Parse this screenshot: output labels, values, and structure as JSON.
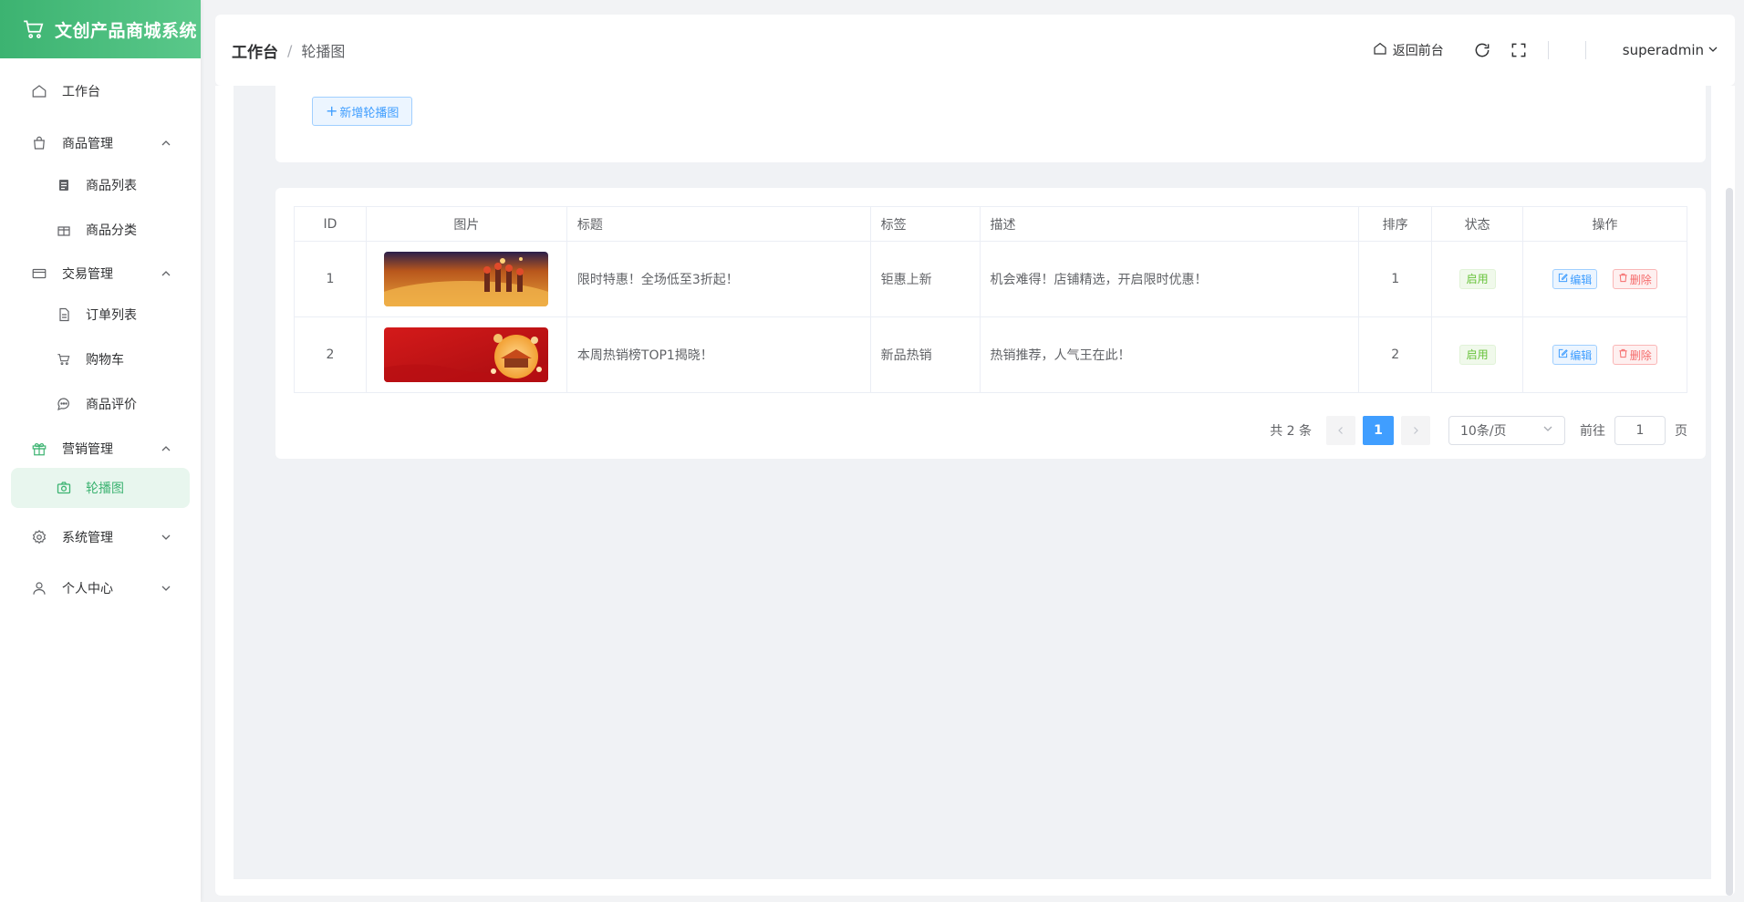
{
  "brand": {
    "title": "文创产品商城系统"
  },
  "sidebar": {
    "items": [
      {
        "label": "工作台"
      },
      {
        "label": "商品管理",
        "children": [
          {
            "label": "商品列表"
          },
          {
            "label": "商品分类"
          }
        ]
      },
      {
        "label": "交易管理",
        "children": [
          {
            "label": "订单列表"
          },
          {
            "label": "购物车"
          },
          {
            "label": "商品评价"
          }
        ]
      },
      {
        "label": "营销管理",
        "children": [
          {
            "label": "轮播图"
          }
        ]
      },
      {
        "label": "系统管理"
      },
      {
        "label": "个人中心"
      }
    ]
  },
  "header": {
    "breadcrumb_main": "工作台",
    "breadcrumb_sep": "/",
    "breadcrumb_sub": "轮播图",
    "back_front": "返回前台",
    "username": "superadmin"
  },
  "toolbar": {
    "add_label": "新增轮播图"
  },
  "table": {
    "columns": [
      "ID",
      "图片",
      "标题",
      "标签",
      "描述",
      "排序",
      "状态",
      "操作"
    ],
    "rows": [
      {
        "id": "1",
        "image": "banner-orange-festival",
        "title": "限时特惠！全场低至3折起！",
        "tag": "钜惠上新",
        "desc": "机会难得！店铺精选，开启限时优惠！",
        "sort": "1",
        "status": "启用"
      },
      {
        "id": "2",
        "image": "banner-red-lantern",
        "title": "本周热销榜TOP1揭晓！",
        "tag": "新品热销",
        "desc": "热销推荐，人气王在此！",
        "sort": "2",
        "status": "启用"
      }
    ],
    "edit_label": "编辑",
    "delete_label": "删除"
  },
  "pagination": {
    "total_text": "共 2 条",
    "current_page": "1",
    "page_size": "10条/页",
    "goto_label": "前往",
    "goto_value": "1",
    "page_suffix": "页"
  },
  "colors": {
    "brand": "#3cb371",
    "primary": "#409eff",
    "danger": "#f56c6c",
    "success": "#67c23a"
  }
}
